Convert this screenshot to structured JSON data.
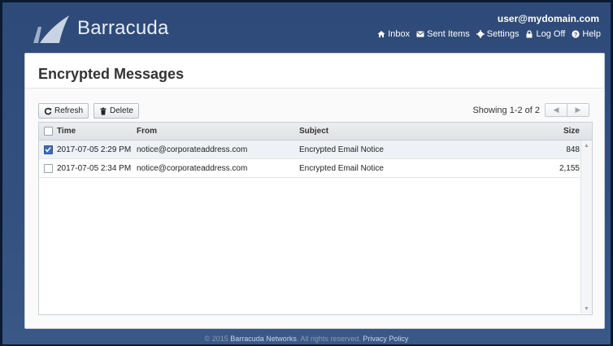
{
  "brand": {
    "name": "Barracuda"
  },
  "header": {
    "user": "user@mydomain.com",
    "nav": [
      {
        "label": "Inbox",
        "icon": "home-icon"
      },
      {
        "label": "Sent Items",
        "icon": "envelope-icon"
      },
      {
        "label": "Settings",
        "icon": "gear-icon"
      },
      {
        "label": "Log Off",
        "icon": "lock-icon"
      },
      {
        "label": "Help",
        "icon": "help-icon"
      }
    ]
  },
  "page": {
    "title": "Encrypted Messages"
  },
  "toolbar": {
    "refresh_label": "Refresh",
    "delete_label": "Delete"
  },
  "paging": {
    "showing": "Showing 1-2 of 2",
    "prev": "◀",
    "next": "▶"
  },
  "table": {
    "columns": {
      "time": "Time",
      "from": "From",
      "subject": "Subject",
      "size": "Size"
    },
    "rows": [
      {
        "time": "2017-07-05 2:29 PM",
        "from": "notice@corporateaddress.com",
        "subject": "Encrypted Email Notice",
        "size": "848",
        "checked": true
      },
      {
        "time": "2017-07-05 2:34 PM",
        "from": "notice@corporateaddress.com",
        "subject": "Encrypted Email Notice",
        "size": "2,155",
        "checked": false
      }
    ]
  },
  "footer": {
    "copyright_prefix": "© 2015",
    "company": "Barracuda Networks",
    "rights": ". All rights reserved.",
    "privacy": "Privacy Policy"
  },
  "colors": {
    "header_bg": "#33507f",
    "accent": "#3b6db8"
  }
}
